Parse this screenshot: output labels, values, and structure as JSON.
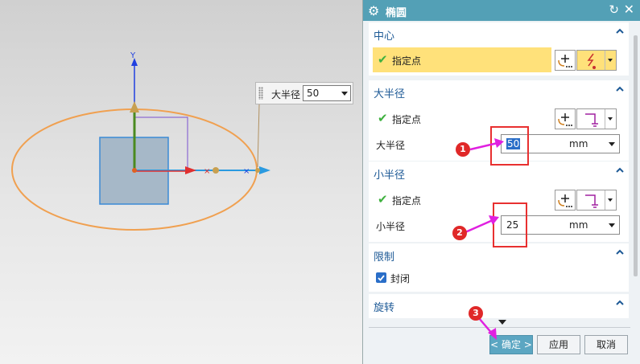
{
  "canvas": {
    "axis_y_label": "Y",
    "length_box": {
      "label": "大半径",
      "value": "50"
    }
  },
  "dialog": {
    "title": "椭圆",
    "icons": {
      "title": "gear-icon",
      "reset": "reset-icon",
      "close": "close-icon"
    },
    "sections": {
      "center": {
        "header": "中心",
        "point_label": "指定点"
      },
      "major": {
        "header": "大半径",
        "point_label": "指定点",
        "radius_label": "大半径",
        "radius_value": "50",
        "unit": "mm"
      },
      "minor": {
        "header": "小半径",
        "point_label": "指定点",
        "radius_label": "小半径",
        "radius_value": "25",
        "unit": "mm"
      },
      "limits": {
        "header": "限制",
        "closed_label": "封闭",
        "closed_checked": true
      },
      "rotation": {
        "header": "旋转"
      }
    },
    "buttons": {
      "ok": "< 确定 >",
      "apply": "应用",
      "cancel": "取消"
    }
  },
  "annotations": {
    "badge_1": "1",
    "badge_2": "2",
    "badge_3": "3"
  },
  "colors": {
    "accent": "#53a0b6",
    "highlight": "#ffe17a",
    "annotation": "#e02828",
    "arrow": "#e020e0",
    "ellipse": "#f0a050"
  }
}
